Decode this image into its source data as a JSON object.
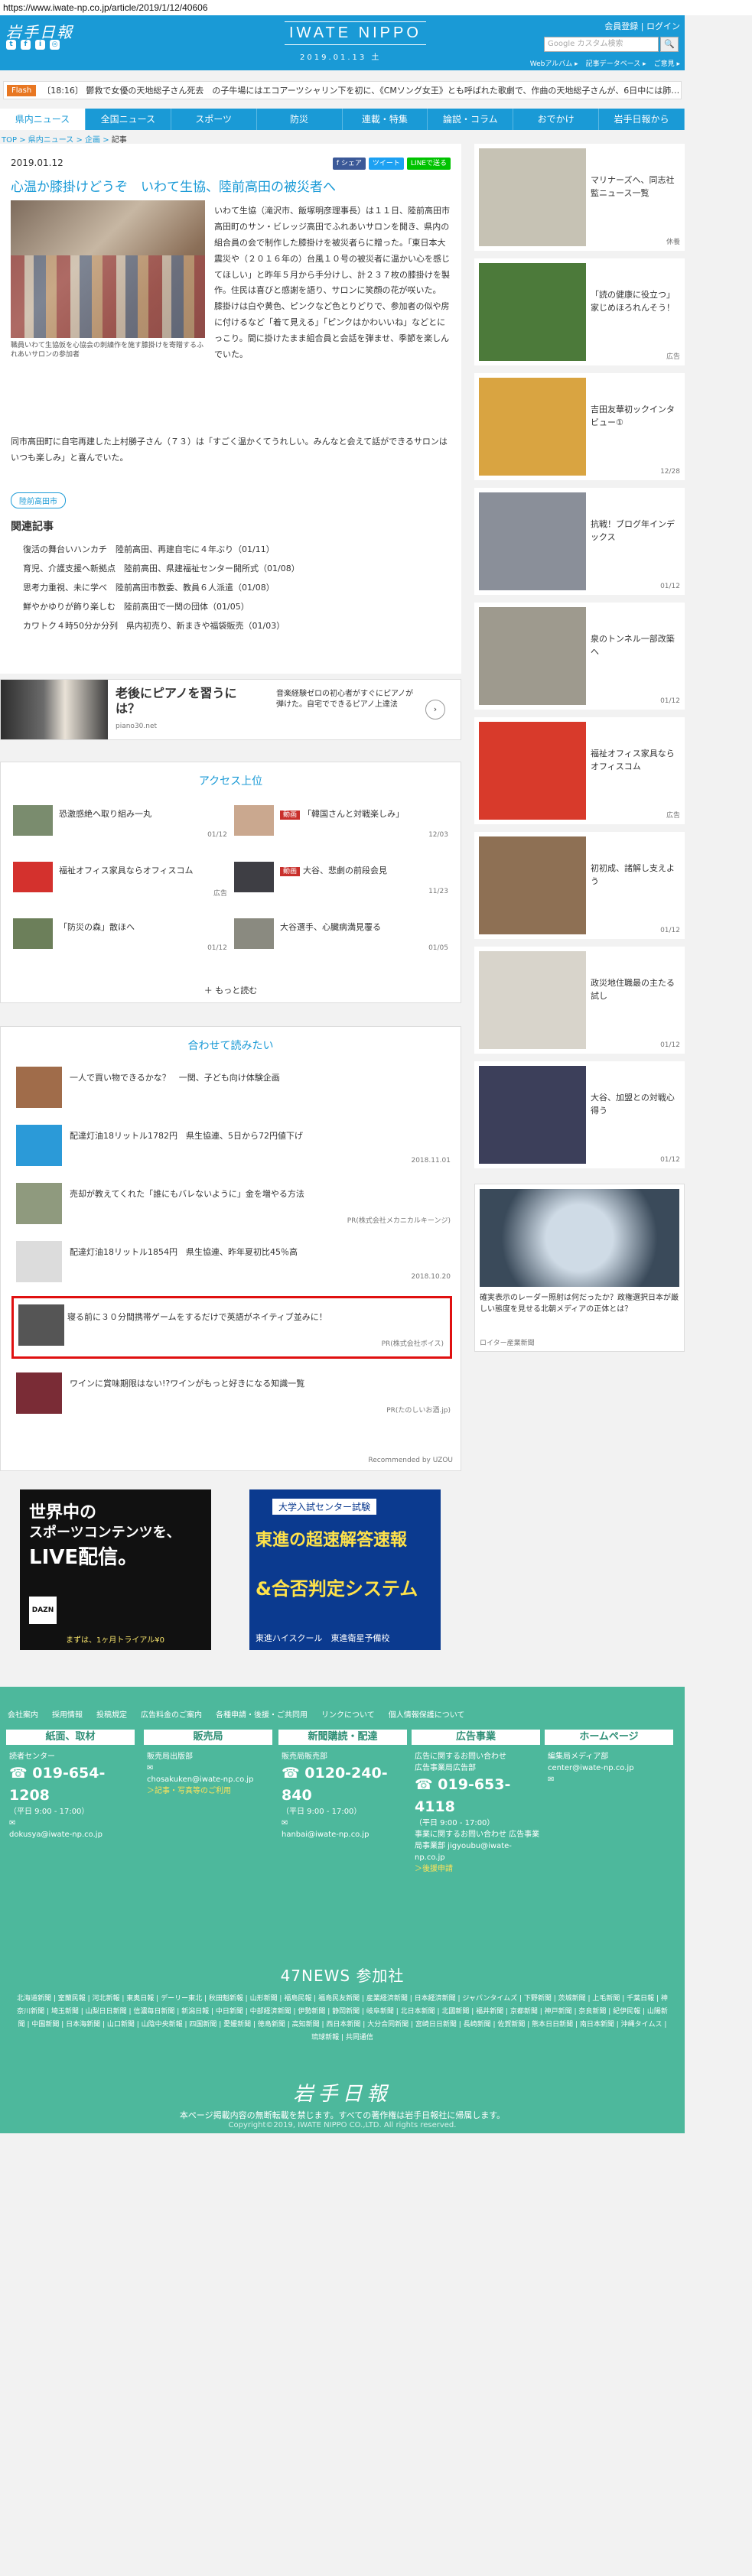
{
  "browser": {
    "url": "https://www.iwate-np.co.jp/article/2019/1/12/40606"
  },
  "header": {
    "logo": "岩手日報",
    "social": [
      "t",
      "f",
      "i",
      "◎"
    ],
    "brand": "IWATE NIPPO",
    "date": "2019.01.13 土",
    "login": "会員登録 | ログイン",
    "search_placeholder": "Google カスタム検索",
    "subnav": [
      "Webアルバム ▸",
      "記事データベース ▸",
      "ご意見 ▸"
    ]
  },
  "flash": {
    "badge": "Flash",
    "text": "〔18:16〕 鬱救で女優の天地総子さん死去　の子牛場にはエコアーツシャリン下を初に、《CMソング女王》とも呼ばれた歌劇で、作曲の天地総子さんが、6日中には肺…"
  },
  "nav": [
    "県内ニュース",
    "全国ニュース",
    "スポーツ",
    "防災",
    "連載・特集",
    "論説・コラム",
    "おでかけ",
    "岩手日報から"
  ],
  "breadcrumb": {
    "top": "TOP",
    "cat1": "県内ニュース",
    "cat2": "企画",
    "cur": "記事"
  },
  "article": {
    "date": "2019.01.12",
    "share": [
      "f シェア",
      "ツイート",
      "LINEで送る"
    ],
    "title": "心温か膝掛けどうぞ　いわて生協、陸前高田の被災者へ",
    "caption": "職員いわて生協仮を心協会の刺繍作を施す膝掛けを寄贈するふれあいサロンの参加者",
    "body1": "いわて生協（滝沢市、飯塚明彦理事長）は１１日、陸前高田市高田町のサン・ビレッジ高田でふれあいサロンを開き、県内の組合員の会で制作した膝掛けを被災者らに贈った。「東日本大震災や（２０１６年の）台風１０号の被災者に温かい心を感じてほしい」と昨年５月から手分けし、計２３７枚の膝掛けを製作。住民は喜びと感謝を語り、サロンに笑顔の花が咲いた。",
    "body1b": "膝掛けは白や黄色、ピンクなど色とりどりで、参加者の似や房に付けるなど「着て見える」「ピンクはかわいいね」などとにっこり。間に掛けたまま組合員と会話を弾ませ、季節を楽しんでいた。",
    "body2": "同市高田町に自宅再建した上村勝子さん（７３）は「すごく温かくてうれしい。みんなと会えて話ができるサロンはいつも楽しみ」と喜んでいた。",
    "tag": "陸前高田市",
    "related_title": "関連記事",
    "related": [
      "復活の舞台いハンカチ　陸前高田、再建自宅に４年ぶり（01/11）",
      "育児、介護支援へ新拠点　陸前高田、県建福祉センター開所式（01/08）",
      "思考力重視、未に学べ　陸前高田市教委、教員６人派遣（01/08）",
      "鮮やかゆりが飾り楽しむ　陸前高田で一関の団体（01/05）",
      "カワトク４時50分か分列　県内初売り、新まきや福袋販売（01/03）"
    ]
  },
  "ad1": {
    "title": "老後にピアノを習うには？",
    "source": "piano30.net",
    "text": "音楽経験ゼロの初心者がすぐにピアノが弾けた。自宅でできるピアノ上達法"
  },
  "access": {
    "title": "アクセス上位",
    "items": [
      {
        "text": "恐激感絶へ取り組み一丸",
        "date": "01/12",
        "badge": ""
      },
      {
        "text": "「韓国さんと対戦楽しみ」",
        "date": "12/03",
        "badge": "動画"
      },
      {
        "text": "福祉オフィス家具ならオフィスコム",
        "date": "広告",
        "badge": ""
      },
      {
        "text": "大谷、悲劇の前段会見",
        "date": "11/23",
        "badge": "動画"
      },
      {
        "text": "「防災の森」散ほへ",
        "date": "01/12",
        "badge": ""
      },
      {
        "text": "大谷選手、心臓病満見覆る",
        "date": "01/05",
        "badge": ""
      }
    ],
    "more": "もっと読む"
  },
  "recommend": {
    "title": "合わせて読みたい",
    "items": [
      {
        "text": "一人で買い物できるかな？　一関、子ども向け体験企画",
        "src": ""
      },
      {
        "text": "配達灯油18リットル1782円　県生協連、5日から72円値下げ",
        "src": "2018.11.01"
      },
      {
        "text": "売却が教えてくれた「誰にもバレないように」金を増やる方法",
        "src": "PR(株式会社メカニカルキーンジ)"
      },
      {
        "text": "配達灯油18リットル1854円　県生協連、昨年夏初比45％高",
        "src": "2018.10.20"
      },
      {
        "text": "寝る前に３０分間携帯ゲームをするだけで英語がネイティブ並みに！",
        "src": "PR(株式会社ボイス)"
      },
      {
        "text": "ワインに賞味期限はない!?ワインがもっと好きになる知識一覧",
        "src": "PR(たのしいお酒.jp)"
      }
    ],
    "powered": "Recommended by UZOU"
  },
  "ads_bottom": [
    {
      "line1": "世界中の",
      "line2": "スポーツコンテンツを、",
      "line3": "LIVE配信。",
      "brand": "DAZN",
      "cta": "まずは、1ヶ月トライアル¥0"
    },
    {
      "line1": "大学入試センター試験",
      "line2": "東進の超速解答速報",
      "line3": "&合否判定システム",
      "brand": "東進ハイスクール　東進衛星予備校"
    }
  ],
  "right": {
    "items": [
      {
        "text": "マリナーズへ、同志社監ニュース一覧",
        "date": "休養"
      },
      {
        "text": "「読の健康に役立つ」家じめほろれんそう！",
        "date": "広告"
      },
      {
        "text": "吉田友華初ックインタビュー①",
        "date": "12/28"
      },
      {
        "text": "抗戦！ブログ年インデックス",
        "date": "01/12"
      },
      {
        "text": "泉のトンネル一部改築へ",
        "date": "01/12"
      },
      {
        "text": "福祉オフィス家具ならオフィスコム",
        "date": "広告"
      },
      {
        "text": "初初成、諸解し支えよう",
        "date": "01/12"
      },
      {
        "text": "政災地住職最の主たる試し",
        "date": "01/12"
      },
      {
        "text": "大谷、加盟との対戦心得う",
        "date": "01/12"
      }
    ],
    "ad_text": "確実表示のレーダー照射は何だったか？政権選択日本が厳しい態度を見せる北朝メディアの正体とは？",
    "ad_source": "ロイター産業新聞"
  },
  "footer": {
    "links": [
      "会社案内",
      "採用情報",
      "投稿規定",
      "広告料金のご案内",
      "各種申請・後援・ご共同用",
      "リンクについて",
      "個人情報保護について"
    ],
    "cols": [
      {
        "head": "紙面、取材",
        "lines": [
          "読者センター"
        ],
        "phone": "019-654-1208",
        "hours": "（平日 9:00 - 17:00）",
        "email": "dokusya@iwate-np.co.jp"
      },
      {
        "head": "販売局",
        "lines": [
          "販売局出版部",
          "chosakuken@iwate-np.co.jp"
        ],
        "phone": "",
        "hours": "",
        "email": "",
        "link": "＞記事・写真等のご利用"
      },
      {
        "head": "新聞購読・配達",
        "lines": [
          "販売局販売部"
        ],
        "phone": "0120-240-840",
        "hours": "（平日 9:00 - 17:00）",
        "email": "hanbai@iwate-np.co.jp"
      },
      {
        "head": "広告事業",
        "lines": [
          "広告に関するお問い合わせ",
          "広告事業局広告部"
        ],
        "phone": "019-653-4118",
        "hours": "（平日 9:00 - 17:00）",
        "email": "事業に関するお問い合わせ 広告事業局事業部 jigyoubu@iwate-np.co.jp",
        "link": "＞後援申請"
      },
      {
        "head": "ホームページ",
        "lines": [
          "編集局メディア部",
          "center@iwate-np.co.jp"
        ],
        "phone": "",
        "hours": "",
        "email": ""
      }
    ],
    "n47": "47NEWS 参加社",
    "papers": "北海道新聞 | 室蘭民報 | 河北新報 | 東奥日報 | デーリー東北 | 秋田魁新報 | 山形新聞 | 福島民報 | 福島民友新聞 | 産業経済新聞 | 日本経済新聞 | ジャパンタイムズ | 下野新聞 | 茨城新聞 | 上毛新聞 | 千葉日報 | 神奈川新聞 | 埼玉新聞 | 山梨日日新聞 | 信濃毎日新聞 | 新潟日報 | 中日新聞 | 中部経済新聞 | 伊勢新聞 | 静岡新聞 | 岐阜新聞 | 北日本新聞 | 北國新聞 | 福井新聞 | 京都新聞 | 神戸新聞 | 奈良新聞 | 紀伊民報 | 山陽新聞 | 中国新聞 | 日本海新聞 | 山口新聞 | 山陰中央新報 | 四国新聞 | 愛媛新聞 | 徳島新聞 | 高知新聞 | 西日本新聞 | 大分合同新聞 | 宮崎日日新聞 | 長崎新聞 | 佐賀新聞 | 熊本日日新聞 | 南日本新聞 | 沖縄タイムス | 琉球新報 | 共同通信",
    "logo": "岩手日報",
    "note": "本ページ掲載内容の無断転載を禁じます。すべての著作権は岩手日報社に帰属します。",
    "copyright": "Copyright©2019, IWATE NIPPO CO.,LTD. All rights reserved."
  }
}
